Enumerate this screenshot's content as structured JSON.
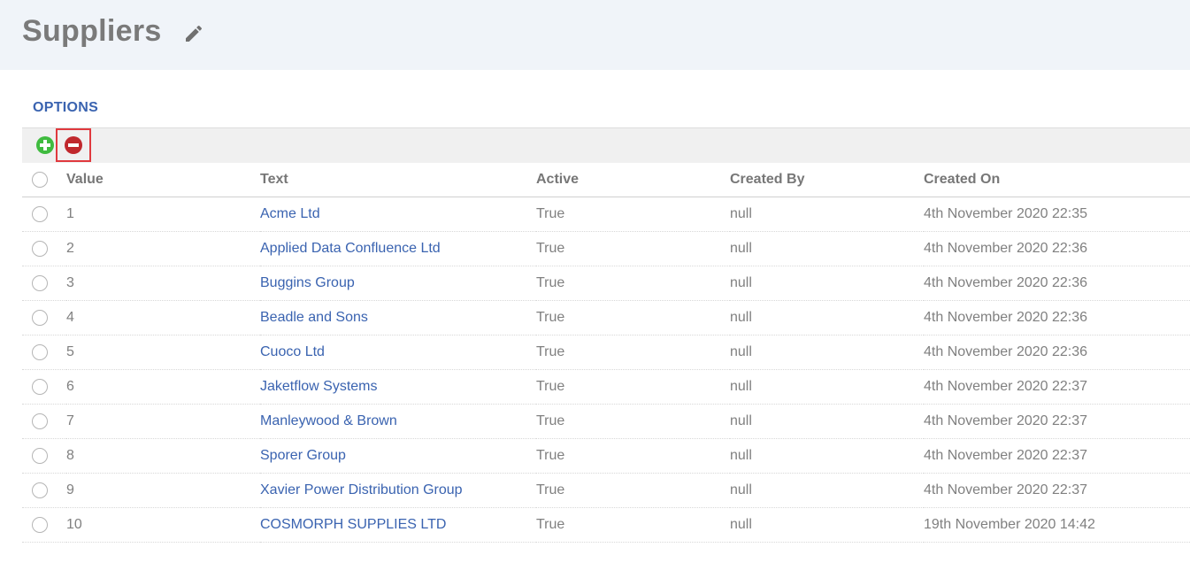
{
  "header": {
    "title": "Suppliers"
  },
  "tabs": [
    {
      "label": "OPTIONS"
    }
  ],
  "colors": {
    "accent": "#3a63b0",
    "add": "#3fbb3f",
    "remove": "#c0282d",
    "highlight": "#e0393e",
    "header_bg": "#f0f4f9"
  },
  "icons": {
    "edit": "pencil-icon",
    "add": "plus-circle-icon",
    "remove": "minus-circle-icon"
  },
  "table": {
    "columns": [
      "Value",
      "Text",
      "Active",
      "Created By",
      "Created On"
    ],
    "rows": [
      {
        "value": "1",
        "text": "Acme Ltd",
        "active": "True",
        "created_by": "null",
        "created_on": "4th November 2020 22:35"
      },
      {
        "value": "2",
        "text": "Applied Data Confluence Ltd",
        "active": "True",
        "created_by": "null",
        "created_on": "4th November 2020 22:36"
      },
      {
        "value": "3",
        "text": "Buggins Group",
        "active": "True",
        "created_by": "null",
        "created_on": "4th November 2020 22:36"
      },
      {
        "value": "4",
        "text": "Beadle and Sons",
        "active": "True",
        "created_by": "null",
        "created_on": "4th November 2020 22:36"
      },
      {
        "value": "5",
        "text": "Cuoco Ltd",
        "active": "True",
        "created_by": "null",
        "created_on": "4th November 2020 22:36"
      },
      {
        "value": "6",
        "text": "Jaketflow Systems",
        "active": "True",
        "created_by": "null",
        "created_on": "4th November 2020 22:37"
      },
      {
        "value": "7",
        "text": "Manleywood & Brown",
        "active": "True",
        "created_by": "null",
        "created_on": "4th November 2020 22:37"
      },
      {
        "value": "8",
        "text": "Sporer Group",
        "active": "True",
        "created_by": "null",
        "created_on": "4th November 2020 22:37"
      },
      {
        "value": "9",
        "text": "Xavier Power Distribution Group",
        "active": "True",
        "created_by": "null",
        "created_on": "4th November 2020 22:37"
      },
      {
        "value": "10",
        "text": "COSMORPH SUPPLIES LTD",
        "active": "True",
        "created_by": "null",
        "created_on": "19th November 2020 14:42"
      }
    ]
  }
}
